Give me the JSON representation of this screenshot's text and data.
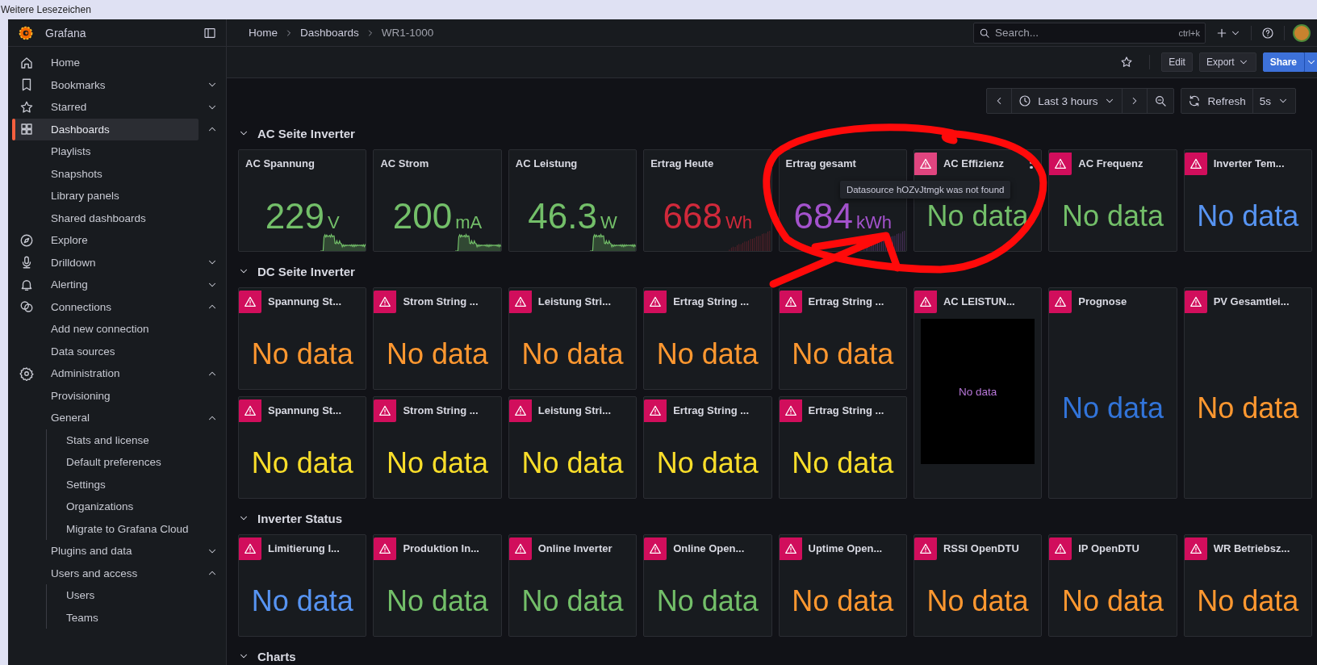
{
  "bookmarks_bar": {
    "label": "Weitere Lesezeichen"
  },
  "sidebar": {
    "title": "Grafana",
    "items": [
      {
        "label": "Home",
        "selected": false
      },
      {
        "label": "Bookmarks",
        "selected": false,
        "expanded": false
      },
      {
        "label": "Starred",
        "selected": false,
        "expanded": false
      },
      {
        "label": "Dashboards",
        "selected": true,
        "expanded": true,
        "children": [
          {
            "label": "Playlists",
            "selected": false
          },
          {
            "label": "Snapshots",
            "selected": false
          },
          {
            "label": "Library panels",
            "selected": false
          },
          {
            "label": "Shared dashboards",
            "selected": false
          }
        ]
      },
      {
        "label": "Explore",
        "selected": false
      },
      {
        "label": "Drilldown",
        "selected": false,
        "expanded": false
      },
      {
        "label": "Alerting",
        "selected": false,
        "expanded": false
      },
      {
        "label": "Connections",
        "selected": false,
        "expanded": true,
        "children": [
          {
            "label": "Add new connection",
            "selected": false
          },
          {
            "label": "Data sources",
            "selected": false
          }
        ]
      },
      {
        "label": "Administration",
        "selected": false,
        "expanded": true,
        "children": [
          {
            "label": "Provisioning",
            "selected": false
          },
          {
            "label": "General",
            "selected": false,
            "expanded": true,
            "children": [
              {
                "label": "Stats and license",
                "selected": false
              },
              {
                "label": "Default preferences",
                "selected": false
              },
              {
                "label": "Settings",
                "selected": false
              },
              {
                "label": "Organizations",
                "selected": false
              },
              {
                "label": "Migrate to Grafana Cloud",
                "selected": false
              }
            ]
          },
          {
            "label": "Plugins and data",
            "selected": false,
            "expanded": false
          },
          {
            "label": "Users and access",
            "selected": false,
            "expanded": true,
            "children": [
              {
                "label": "Users",
                "selected": false
              },
              {
                "label": "Teams",
                "selected": false
              }
            ]
          }
        ]
      }
    ]
  },
  "topbar": {
    "breadcrumbs": [
      "Home",
      "Dashboards",
      "WR1-1000"
    ],
    "search": {
      "placeholder": "Search...",
      "shortcut": "ctrl+k"
    }
  },
  "toolbar": {
    "buttons": [
      "Edit",
      "Export",
      "Share"
    ]
  },
  "time_controls": {
    "range": "Last 3 hours",
    "refresh": "Refresh",
    "interval": "5s"
  },
  "sections": [
    {
      "title": "AC Seite Inverter",
      "expanded": true,
      "panels": [
        {
          "kind": "stat",
          "title": "AC Spannung",
          "error": false,
          "value": "229",
          "unit": "V",
          "color": "#73bf69",
          "sparkline": {
            "kind": "area"
          }
        },
        {
          "kind": "stat",
          "title": "AC Strom",
          "error": false,
          "value": "200",
          "unit": "mA",
          "color": "#73bf69",
          "sparkline": {
            "kind": "area"
          }
        },
        {
          "kind": "stat",
          "title": "AC Leistung",
          "error": false,
          "value": "46.3",
          "unit": "W",
          "color": "#73bf69",
          "sparkline": {
            "kind": "area"
          }
        },
        {
          "kind": "stat",
          "title": "Ertrag Heute",
          "error": false,
          "value": "668",
          "unit": "Wh",
          "color": "#d0293b",
          "sparkline": {
            "kind": "bars"
          }
        },
        {
          "kind": "stat",
          "title": "Ertrag gesamt",
          "error": false,
          "value": "684",
          "unit": "kWh",
          "color": "#a352cc",
          "sparkline": {
            "kind": "bars"
          }
        },
        {
          "kind": "stat",
          "title": "AC Effizienz",
          "error": true,
          "hovered": true,
          "tooltip": "Datasource hOZvJtmgk was not found",
          "value": "No data",
          "color": "#73bf69"
        },
        {
          "kind": "stat",
          "title": "AC Frequenz",
          "error": true,
          "value": "No data",
          "color": "#73bf69"
        },
        {
          "kind": "stat",
          "title": "Inverter Tem...",
          "error": true,
          "value": "No data",
          "color": "#5794f2"
        }
      ]
    },
    {
      "title": "DC Seite Inverter",
      "expanded": true,
      "panels": [
        {
          "kind": "stat",
          "title": "Spannung St...",
          "error": true,
          "value": "No data",
          "color": "#ff9830"
        },
        {
          "kind": "stat",
          "title": "Strom String ...",
          "error": true,
          "value": "No data",
          "color": "#ff9830"
        },
        {
          "kind": "stat",
          "title": "Leistung Stri...",
          "error": true,
          "value": "No data",
          "color": "#ff9830"
        },
        {
          "kind": "stat",
          "title": "Ertrag String ...",
          "error": true,
          "value": "No data",
          "color": "#ff9830"
        },
        {
          "kind": "stat",
          "title": "Ertrag String ...",
          "error": true,
          "value": "No data",
          "color": "#ff9830"
        },
        {
          "kind": "graph",
          "title": "AC LEISTUN...",
          "error": true,
          "tall": true,
          "value": "No data",
          "color": "#b877d9"
        },
        {
          "kind": "stat",
          "title": "Prognose",
          "error": true,
          "tall": true,
          "value": "No data",
          "color": "#3274d9"
        },
        {
          "kind": "stat",
          "title": "PV Gesamtlei...",
          "error": true,
          "tall": true,
          "value": "No data",
          "color": "#ff9830"
        },
        {
          "kind": "stat",
          "title": "Spannung St...",
          "error": true,
          "value": "No data",
          "color": "#fade2a"
        },
        {
          "kind": "stat",
          "title": "Strom String ...",
          "error": true,
          "value": "No data",
          "color": "#fade2a"
        },
        {
          "kind": "stat",
          "title": "Leistung Stri...",
          "error": true,
          "value": "No data",
          "color": "#fade2a"
        },
        {
          "kind": "stat",
          "title": "Ertrag String ...",
          "error": true,
          "value": "No data",
          "color": "#fade2a"
        },
        {
          "kind": "stat",
          "title": "Ertrag String ...",
          "error": true,
          "value": "No data",
          "color": "#fade2a"
        }
      ]
    },
    {
      "title": "Inverter Status",
      "expanded": true,
      "panels": [
        {
          "kind": "stat",
          "title": "Limitierung I...",
          "error": true,
          "value": "No data",
          "color": "#5794f2"
        },
        {
          "kind": "stat",
          "title": "Produktion In...",
          "error": true,
          "value": "No data",
          "color": "#73bf69"
        },
        {
          "kind": "stat",
          "title": "Online Inverter",
          "error": true,
          "value": "No data",
          "color": "#73bf69"
        },
        {
          "kind": "stat",
          "title": "Online Open...",
          "error": true,
          "value": "No data",
          "color": "#73bf69"
        },
        {
          "kind": "stat",
          "title": "Uptime Open...",
          "error": true,
          "value": "No data",
          "color": "#ff9830"
        },
        {
          "kind": "stat",
          "title": "RSSI OpenDTU",
          "error": true,
          "value": "No data",
          "color": "#ff9830"
        },
        {
          "kind": "stat",
          "title": "IP OpenDTU",
          "error": true,
          "value": "No data",
          "color": "#ff9830"
        },
        {
          "kind": "stat",
          "title": "WR Betriebsz...",
          "error": true,
          "value": "No data",
          "color": "#ff9830"
        }
      ]
    },
    {
      "title": "Charts",
      "expanded": true
    }
  ],
  "annotation": {
    "kind": "circle-arrow"
  }
}
